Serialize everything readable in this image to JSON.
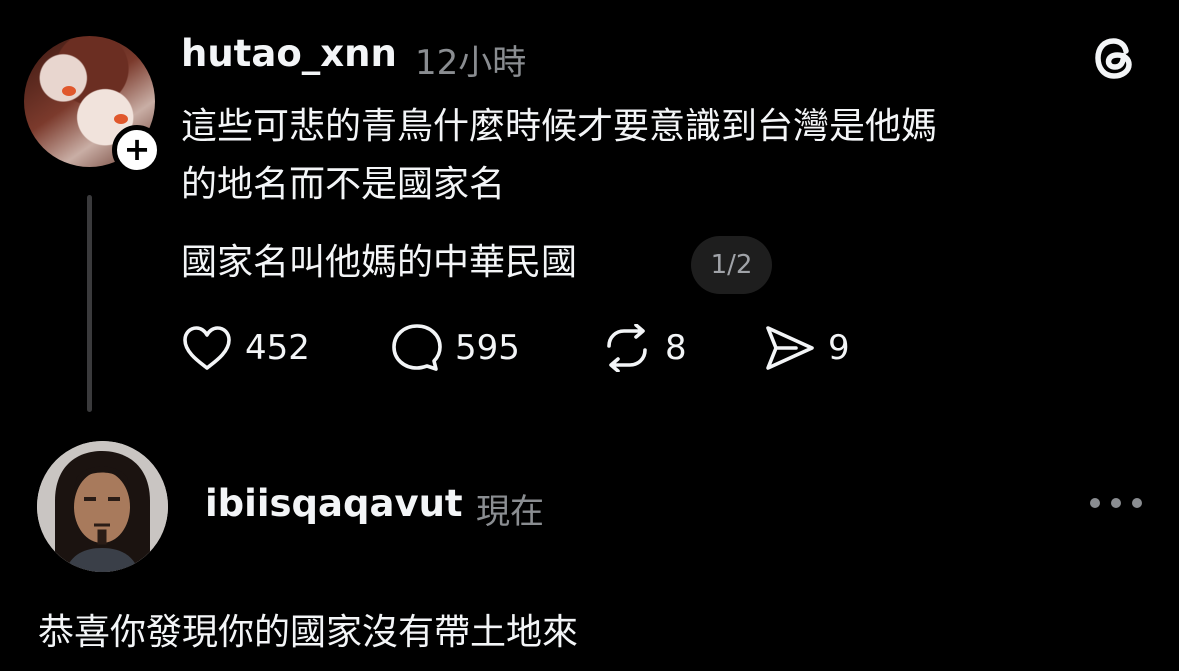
{
  "post": {
    "username": "hutao_xnn",
    "time": "12小時",
    "lines": [
      "這些可悲的青鳥什麼時候才要意識到台灣是他媽",
      "的地名而不是國家名",
      "國家名叫他媽的中華民國"
    ],
    "page_counter": "1/2",
    "follow_icon": "plus-icon",
    "actions": {
      "likes": "452",
      "replies": "595",
      "reposts": "8",
      "shares": "9"
    }
  },
  "reply": {
    "username": "ibiisqaqavut",
    "time": "現在",
    "text": "恭喜你發現你的國家沒有帶土地來"
  },
  "icons": {
    "brand": "threads-logo-icon",
    "like": "heart-icon",
    "reply": "speech-bubble-icon",
    "repost": "repost-icon",
    "share": "send-icon",
    "more": "more-horizontal-icon"
  },
  "colors": {
    "background": "#000000",
    "text_primary": "#f3f5f7",
    "text_secondary": "#8a8d91"
  }
}
